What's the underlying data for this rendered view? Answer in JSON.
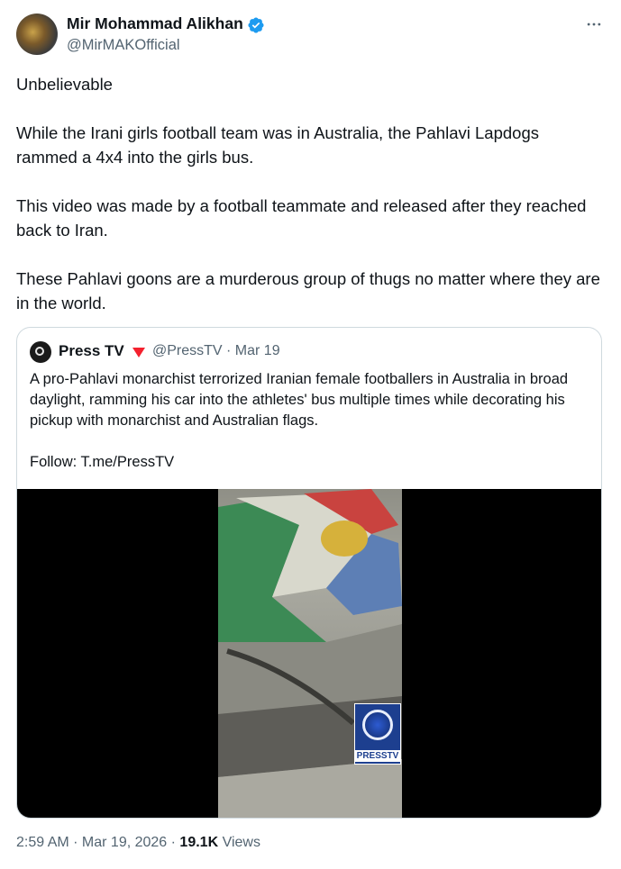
{
  "author": {
    "display_name": "Mir Mohammad Alikhan",
    "handle": "@MirMAKOfficial",
    "verified": true
  },
  "tweet": {
    "paragraphs": [
      "Unbelievable",
      "While the Irani girls football team was in Australia, the Pahlavi Lapdogs rammed a 4x4 into the girls bus.",
      "This video was made by a football teammate and released after they reached back to Iran.",
      "These Pahlavi goons are a murderous group of thugs no matter where they are in the world."
    ]
  },
  "quote": {
    "display_name": "Press TV",
    "meta": "@PressTV · Mar 19",
    "paragraphs": [
      "A pro-Pahlavi monarchist terrorized Iranian female footballers in Australia in broad daylight, ramming his car into the athletes' bus multiple times while decorating his pickup with monarchist and Australian flags.",
      "Follow: T.me/PressTV"
    ],
    "video_logo_text": "PRESSTV"
  },
  "footer": {
    "timestamp": "2:59 AM · Mar 19, 2026 · ",
    "views_count": "19.1K",
    "views_label": "Views"
  },
  "colors": {
    "text": "#0f1419",
    "secondary": "#536471",
    "verified_blue": "#1d9bf0",
    "border": "#cfd9de",
    "flag_red": "#f4212e"
  },
  "icons": {
    "verified": "verified-badge-icon",
    "more": "more-options-icon",
    "flag": "red-triangle-icon"
  }
}
